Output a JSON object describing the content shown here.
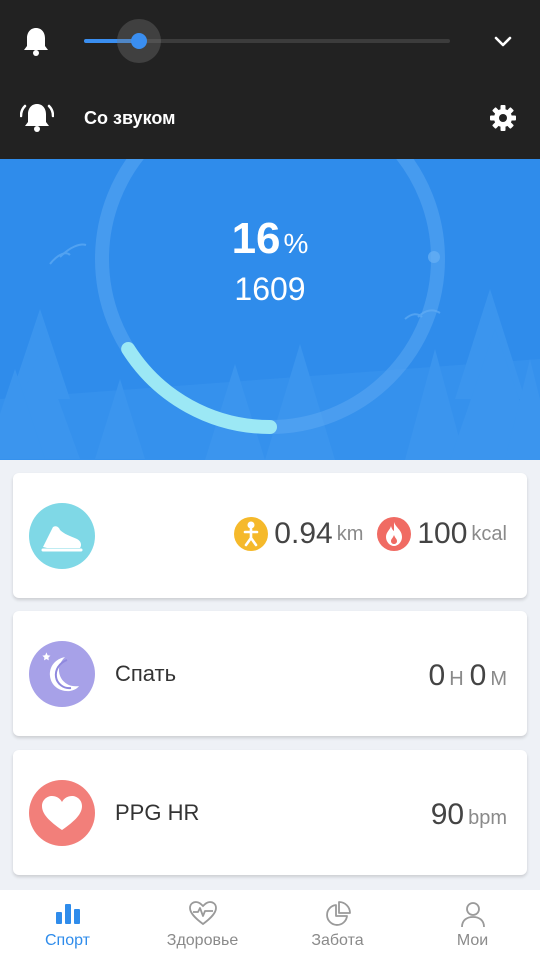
{
  "shade": {
    "volume_level": 0.15,
    "sound_mode_label": "Со звуком"
  },
  "goal": {
    "percent_value": "16",
    "percent_sign": "%",
    "percent_fraction": 0.16,
    "steps": "1609"
  },
  "activity": {
    "distance_value": "0.94",
    "distance_unit": "km",
    "calories_value": "100",
    "calories_unit": "kcal"
  },
  "sleep": {
    "label": "Спать",
    "hours": "0",
    "hours_unit": "Н",
    "minutes": "0",
    "minutes_unit": "М"
  },
  "heart": {
    "label": "PPG HR",
    "value": "90",
    "unit": "bpm"
  },
  "nav": {
    "items": [
      {
        "label": "Спорт",
        "icon": "bar-chart-icon",
        "active": true
      },
      {
        "label": "Здоровье",
        "icon": "heart-pulse-icon",
        "active": false
      },
      {
        "label": "Забота",
        "icon": "pie-chart-icon",
        "active": false
      },
      {
        "label": "Мои",
        "icon": "person-icon",
        "active": false
      }
    ]
  },
  "colors": {
    "accent": "#2f8ceb",
    "shade_bg": "#222222",
    "shoe_circle": "#7fd8e6",
    "moon_circle": "#a7a1e8",
    "heart_circle": "#f27f7a",
    "distance_badge": "#f5b92b",
    "calories_badge": "#f06b63"
  }
}
